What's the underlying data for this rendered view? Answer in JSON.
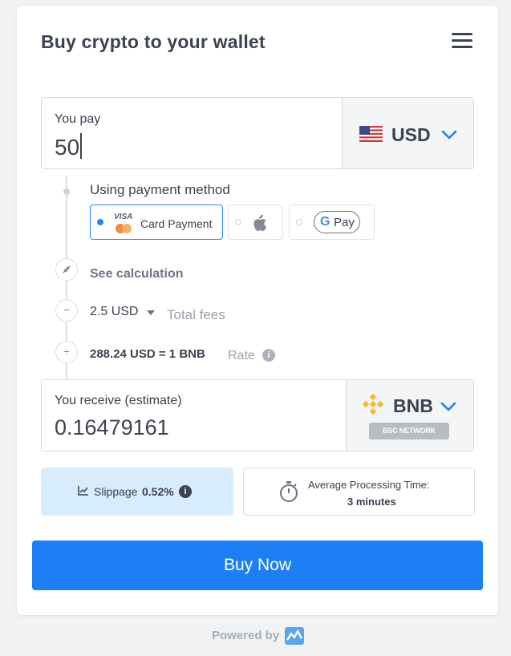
{
  "header": {
    "title": "Buy crypto to your wallet"
  },
  "pay": {
    "label": "You pay",
    "amount": "50",
    "currency": "USD"
  },
  "payment_method": {
    "label": "Using payment method",
    "options": [
      {
        "name": "Card Payment",
        "brand_text": "VISA",
        "selected": true
      },
      {
        "name": "Apple Pay",
        "selected": false
      },
      {
        "name": "Google Pay",
        "pay_text": "Pay",
        "selected": false
      }
    ]
  },
  "calculation": {
    "see_calc": "See calculation",
    "fee_amount": "2.5 USD",
    "fee_label": "Total fees",
    "rate_value": "288.24 USD = 1 BNB",
    "rate_label": "Rate"
  },
  "receive": {
    "label": "You receive (estimate)",
    "amount": "0.16479161",
    "currency": "BNB",
    "network": "BSC NETWORK"
  },
  "slippage": {
    "label": "Slippage",
    "value": "0.52%"
  },
  "processing": {
    "label": "Average Processing Time:",
    "value": "3 minutes"
  },
  "buy_button": "Buy Now",
  "footer": {
    "powered_by": "Powered by"
  },
  "colors": {
    "accent": "#1e7ff5",
    "slippage_bg": "#d7ecfd",
    "bnb": "#f3ba2f"
  }
}
